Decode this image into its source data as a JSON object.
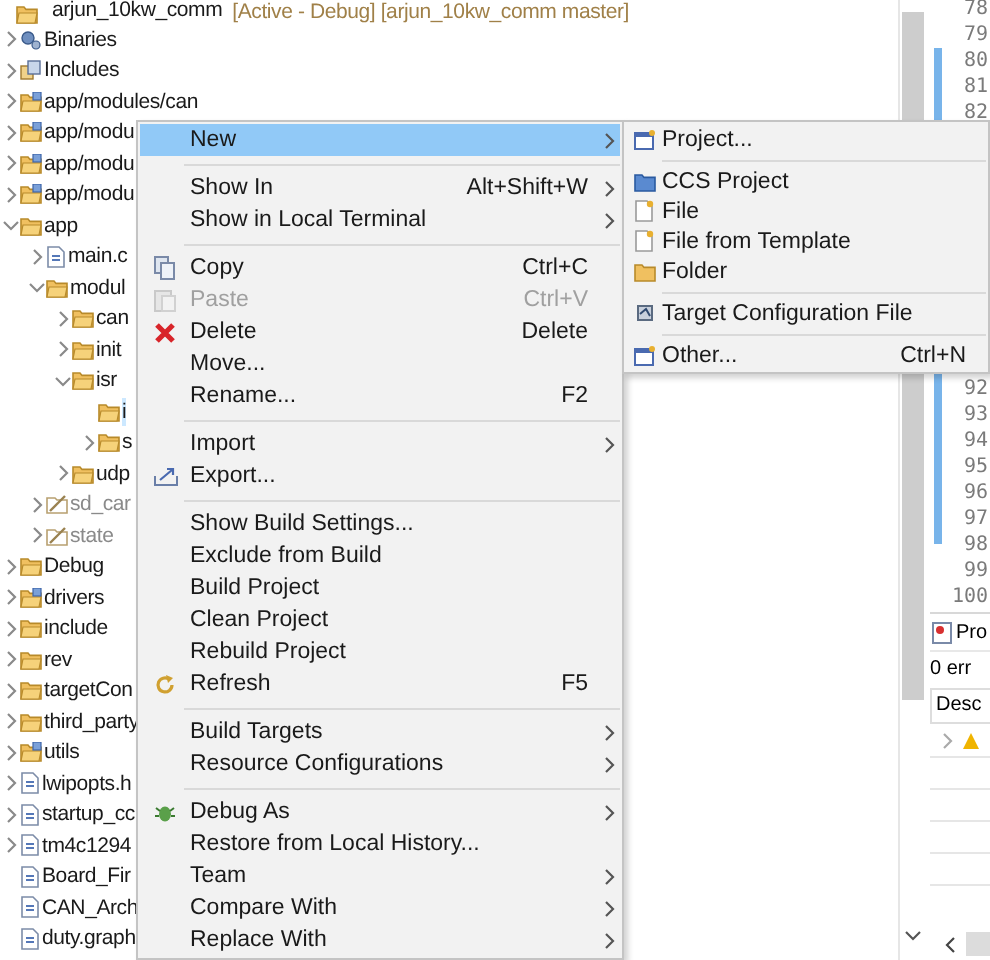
{
  "tree": {
    "project": {
      "name": "arjun_10kw_comm",
      "status": "[Active - Debug] [arjun_10kw_comm master]"
    },
    "items": [
      {
        "label": "Binaries",
        "kind": "binaries",
        "expanded": false,
        "selected": false
      },
      {
        "label": "Includes",
        "kind": "includes",
        "expanded": false,
        "selected": false
      },
      {
        "label": "app/modules/can",
        "kind": "source",
        "expanded": false,
        "selected": false
      },
      {
        "label": "app/modu",
        "kind": "source",
        "expanded": false,
        "selected": false
      },
      {
        "label": "app/modu",
        "kind": "source",
        "expanded": false,
        "selected": false
      },
      {
        "label": "app/modu",
        "kind": "source",
        "expanded": false,
        "selected": false
      },
      {
        "label": "app",
        "kind": "folder",
        "expanded": true,
        "selected": false,
        "children": [
          {
            "label": "main.c",
            "kind": "file",
            "expanded": false,
            "selected": false
          },
          {
            "label": "modul",
            "kind": "folder",
            "expanded": true,
            "selected": false,
            "children": [
              {
                "label": "can",
                "kind": "folder",
                "expanded": false,
                "selected": false
              },
              {
                "label": "init",
                "kind": "folder",
                "expanded": false,
                "selected": false
              },
              {
                "label": "isr",
                "kind": "folder",
                "expanded": true,
                "selected": false,
                "children": [
                  {
                    "label": "i",
                    "kind": "folder",
                    "selected": true
                  },
                  {
                    "label": "s",
                    "kind": "folder",
                    "expanded": false,
                    "selected": false
                  }
                ]
              },
              {
                "label": "udp",
                "kind": "folder",
                "expanded": false,
                "selected": false
              }
            ]
          },
          {
            "label": "sd_car",
            "kind": "excluded",
            "expanded": false,
            "selected": false
          },
          {
            "label": "state",
            "kind": "excluded",
            "expanded": false,
            "selected": false
          }
        ]
      },
      {
        "label": "Debug",
        "kind": "folder",
        "expanded": false,
        "selected": false
      },
      {
        "label": "drivers",
        "kind": "source",
        "expanded": false,
        "selected": false
      },
      {
        "label": "include",
        "kind": "folder",
        "expanded": false,
        "selected": false
      },
      {
        "label": "rev",
        "kind": "folder",
        "expanded": false,
        "selected": false
      },
      {
        "label": "targetCon",
        "kind": "folder",
        "expanded": false,
        "selected": false
      },
      {
        "label": "third_party",
        "kind": "folder",
        "expanded": false,
        "selected": false
      },
      {
        "label": "utils",
        "kind": "source",
        "expanded": false,
        "selected": false
      },
      {
        "label": "lwipopts.h",
        "kind": "file",
        "expanded": false,
        "selected": false
      },
      {
        "label": "startup_cc",
        "kind": "file",
        "expanded": false,
        "selected": false
      },
      {
        "label": "tm4c1294",
        "kind": "file",
        "expanded": false,
        "selected": false
      },
      {
        "label": "Board_Fir",
        "kind": "file",
        "selected": false
      },
      {
        "label": "CAN_Arch",
        "kind": "file",
        "selected": false
      },
      {
        "label": "duty.graph",
        "kind": "file",
        "selected": false
      }
    ]
  },
  "context_menu": {
    "items": [
      {
        "kind": "item",
        "label": "New",
        "submenu": true,
        "disabled": false,
        "selected": true
      },
      {
        "kind": "separator"
      },
      {
        "kind": "item",
        "label": "Show In",
        "shortcut": "Alt+Shift+W",
        "submenu": true,
        "disabled": false,
        "selected": false
      },
      {
        "kind": "item",
        "label": "Show in Local Terminal",
        "submenu": true,
        "disabled": false,
        "selected": false
      },
      {
        "kind": "separator"
      },
      {
        "kind": "item",
        "label": "Copy",
        "shortcut": "Ctrl+C",
        "submenu": false,
        "disabled": false,
        "selected": false
      },
      {
        "kind": "item",
        "label": "Paste",
        "shortcut": "Ctrl+V",
        "submenu": false,
        "disabled": true,
        "selected": false
      },
      {
        "kind": "item",
        "label": "Delete",
        "shortcut": "Delete",
        "submenu": false,
        "disabled": false,
        "selected": false
      },
      {
        "kind": "item",
        "label": "Move...",
        "submenu": false,
        "disabled": false,
        "selected": false
      },
      {
        "kind": "item",
        "label": "Rename...",
        "shortcut": "F2",
        "submenu": false,
        "disabled": false,
        "selected": false
      },
      {
        "kind": "separator"
      },
      {
        "kind": "item",
        "label": "Import",
        "submenu": true,
        "disabled": false,
        "selected": false
      },
      {
        "kind": "item",
        "label": "Export...",
        "submenu": false,
        "disabled": false,
        "selected": false
      },
      {
        "kind": "separator"
      },
      {
        "kind": "item",
        "label": "Show Build Settings...",
        "submenu": false,
        "disabled": false,
        "selected": false
      },
      {
        "kind": "item",
        "label": "Exclude from Build",
        "submenu": false,
        "disabled": false,
        "selected": false
      },
      {
        "kind": "item",
        "label": "Build Project",
        "submenu": false,
        "disabled": false,
        "selected": false
      },
      {
        "kind": "item",
        "label": "Clean Project",
        "submenu": false,
        "disabled": false,
        "selected": false
      },
      {
        "kind": "item",
        "label": "Rebuild Project",
        "submenu": false,
        "disabled": false,
        "selected": false
      },
      {
        "kind": "item",
        "label": "Refresh",
        "shortcut": "F5",
        "submenu": false,
        "disabled": false,
        "selected": false
      },
      {
        "kind": "separator"
      },
      {
        "kind": "item",
        "label": "Build Targets",
        "submenu": true,
        "disabled": false,
        "selected": false
      },
      {
        "kind": "item",
        "label": "Resource Configurations",
        "submenu": true,
        "disabled": false,
        "selected": false
      },
      {
        "kind": "separator"
      },
      {
        "kind": "item",
        "label": "Debug As",
        "submenu": true,
        "disabled": false,
        "selected": false
      },
      {
        "kind": "item",
        "label": "Restore from Local History...",
        "submenu": false,
        "disabled": false,
        "selected": false
      },
      {
        "kind": "item",
        "label": "Team",
        "submenu": true,
        "disabled": false,
        "selected": false
      },
      {
        "kind": "item",
        "label": "Compare With",
        "submenu": true,
        "disabled": false,
        "selected": false
      },
      {
        "kind": "item",
        "label": "Replace With",
        "submenu": true,
        "disabled": false,
        "selected": false
      }
    ]
  },
  "submenu": {
    "items": [
      {
        "kind": "item",
        "label": "Project...",
        "selected": false
      },
      {
        "kind": "separator"
      },
      {
        "kind": "item",
        "label": "CCS Project",
        "selected": false
      },
      {
        "kind": "item",
        "label": "File",
        "selected": false
      },
      {
        "kind": "item",
        "label": "File from Template",
        "selected": false
      },
      {
        "kind": "item",
        "label": "Folder",
        "selected": false
      },
      {
        "kind": "separator"
      },
      {
        "kind": "item",
        "label": "Target Configuration File",
        "selected": false
      },
      {
        "kind": "separator"
      },
      {
        "kind": "item",
        "label": "Other...",
        "shortcut": "Ctrl+N",
        "selected": false
      }
    ]
  },
  "editor": {
    "line_groups": [
      [
        "78",
        "79",
        "80",
        "81",
        "82"
      ],
      [
        "92",
        "93",
        "94",
        "95",
        "96",
        "97",
        "98",
        "99",
        "100"
      ]
    ]
  },
  "problems": {
    "tab": "Pro",
    "summary": "0 err",
    "column_1": "Desc",
    "rows": [
      {
        "kind": "warning",
        "expanded": false
      }
    ]
  }
}
